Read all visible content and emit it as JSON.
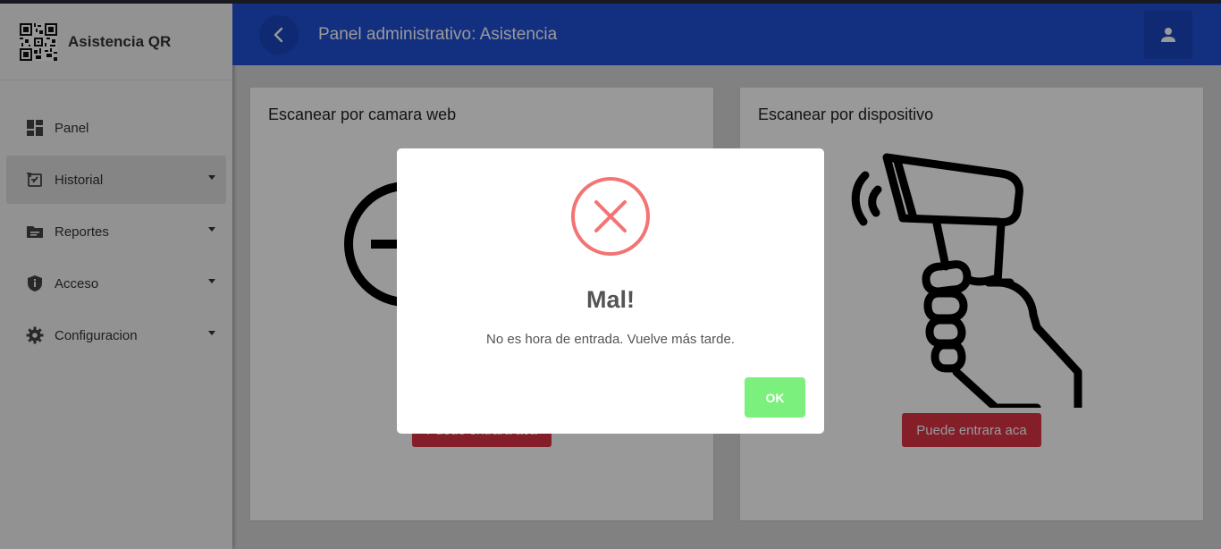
{
  "app": {
    "name": "Asistencia QR"
  },
  "sidebar": {
    "items": [
      {
        "label": "Panel",
        "icon": "dashboard-icon"
      },
      {
        "label": "Historial",
        "icon": "history-icon"
      },
      {
        "label": "Reportes",
        "icon": "folder-icon"
      },
      {
        "label": "Acceso",
        "icon": "shield-icon"
      },
      {
        "label": "Configuracion",
        "icon": "gear-icon"
      }
    ]
  },
  "header": {
    "title": "Panel administrativo: Asistencia"
  },
  "cards": {
    "webcam": {
      "title": "Escanear por camara web",
      "button": "Puede entrara aca"
    },
    "device": {
      "title": "Escanear por dispositivo",
      "button": "Puede entrara aca"
    }
  },
  "modal": {
    "title": "Mal!",
    "text": "No es hora de entrada. Vuelve más tarde.",
    "ok_label": "OK",
    "icon": "error-x-icon"
  },
  "colors": {
    "header": "#1e4fd6",
    "error": "#f27474",
    "ok_button": "#7cf07c",
    "danger_button": "#dc3545"
  }
}
